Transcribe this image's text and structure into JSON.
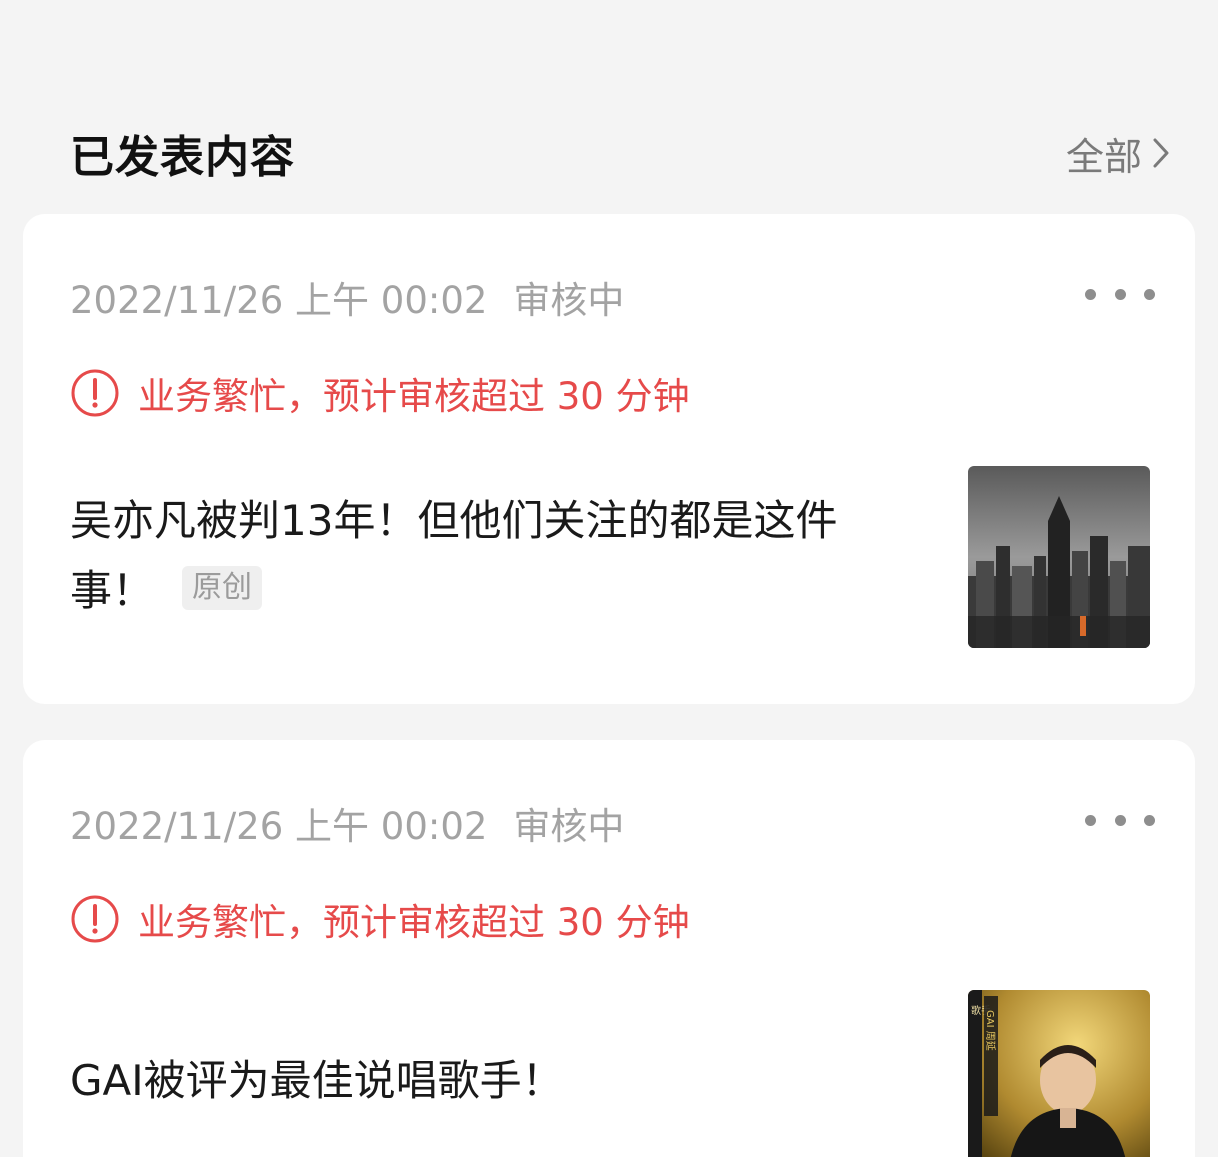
{
  "section": {
    "title": "已发表内容",
    "view_all": "全部"
  },
  "posts": [
    {
      "date": "2022/11/26 上午 00:02",
      "status": "审核中",
      "alert": "业务繁忙，预计审核超过 30 分钟",
      "title": "吴亦凡被判13年！但他们关注的都是这件事！",
      "tag": "原创",
      "thumbnail": "city-skyline-image"
    },
    {
      "date": "2022/11/26 上午 00:02",
      "status": "审核中",
      "alert": "业务繁忙，预计审核超过 30 分钟",
      "title": "GAI被评为最佳说唱歌手！",
      "thumbnail": "singer-poster-image",
      "thumbnail_text": {
        "label": "歌手",
        "name": "GAI 周延"
      }
    }
  ],
  "colors": {
    "alert": "#e64a4a",
    "meta": "#a3a3a3",
    "background": "#f4f4f4"
  }
}
